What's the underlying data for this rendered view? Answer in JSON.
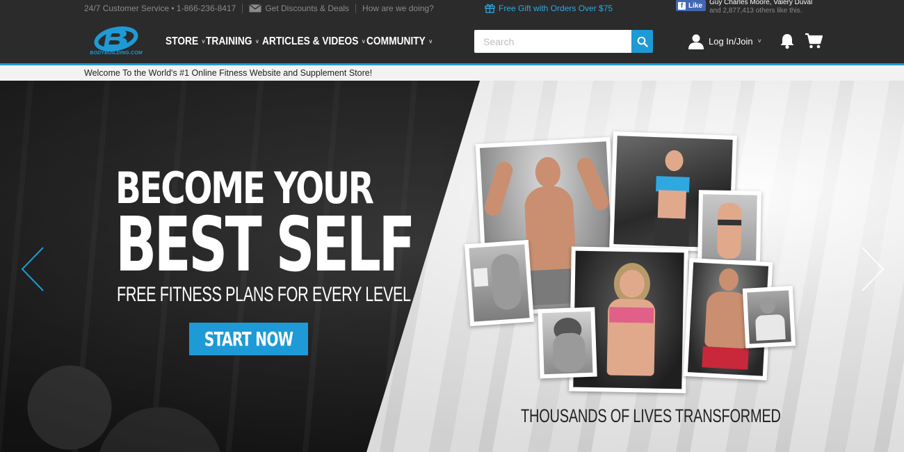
{
  "utility": {
    "service_text": "24/7 Customer Service • 1-866-236-8417",
    "discounts_text": "Get Discounts & Deals",
    "feedback_text": "How are we doing?",
    "gift_text": "Free Gift with Orders Over $75",
    "fb_like_label": "Like",
    "fb_friends_text": "Guy Charles Moore, Valery Duval",
    "fb_others_text": "and 2,877,413 others like this."
  },
  "logo": {
    "text": "BODYBUILDING.COM"
  },
  "nav": {
    "items": [
      {
        "label": "STORE"
      },
      {
        "label": "TRAINING"
      },
      {
        "label": "ARTICLES & VIDEOS"
      },
      {
        "label": "COMMUNITY"
      }
    ],
    "search_placeholder": "Search",
    "login_label": "Log In/Join"
  },
  "welcome_text": "Welcome To the World's #1 Online Fitness Website and Supplement Store!",
  "hero": {
    "headline_line1": "BECOME YOUR",
    "headline_line2": "BEST SELF",
    "subline": "FREE FITNESS PLANS FOR EVERY LEVEL",
    "cta_label": "START NOW",
    "caption": "THOUSANDS OF LIVES TRANSFORMED"
  },
  "colors": {
    "accent": "#1e9ad6",
    "topbar": "#2b2b2b",
    "facebook": "#4267b2"
  }
}
